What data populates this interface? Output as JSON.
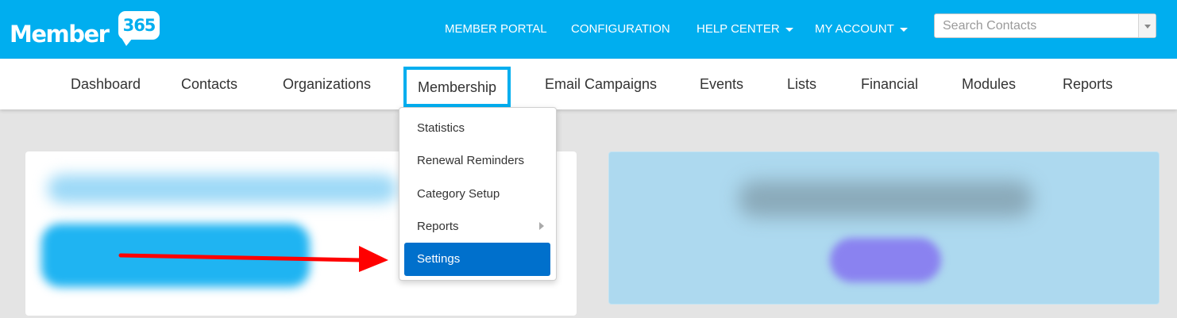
{
  "brand": {
    "name": "Member",
    "badge": "365"
  },
  "header": {
    "nav": [
      {
        "label": "MEMBER PORTAL",
        "dropdown": false
      },
      {
        "label": "CONFIGURATION",
        "dropdown": false
      },
      {
        "label": "HELP CENTER",
        "dropdown": true
      },
      {
        "label": "MY ACCOUNT",
        "dropdown": true
      }
    ],
    "search": {
      "placeholder": "Search Contacts",
      "value": ""
    }
  },
  "main_nav": {
    "items": [
      "Dashboard",
      "Contacts",
      "Organizations",
      "Membership",
      "Email Campaigns",
      "Events",
      "Lists",
      "Financial",
      "Modules",
      "Reports"
    ],
    "highlighted": "Membership"
  },
  "membership_menu": {
    "items": [
      "Statistics",
      "Renewal Reminders",
      "Category Setup",
      "Reports",
      "Settings"
    ],
    "has_submenu": "Reports",
    "selected": "Settings"
  },
  "colors": {
    "header_bg": "#00aeef",
    "highlight_border": "#00aeef",
    "menu_active": "#0070cc",
    "annotation_arrow": "#ff0000"
  }
}
